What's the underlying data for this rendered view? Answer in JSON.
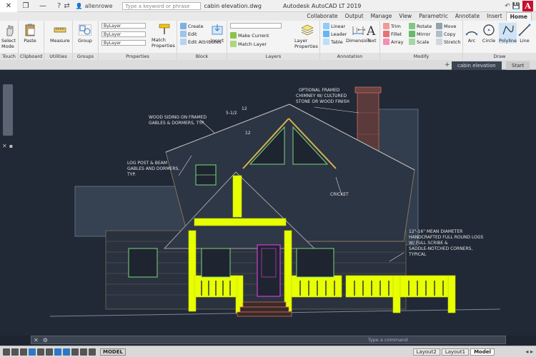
{
  "titlebar": {
    "title": "Autodesk AutoCAD LT 2019",
    "filename": "cabin elevation.dwg",
    "search_placeholder": "Type a keyword or phrase",
    "user": "allenrowe"
  },
  "ribbon_tabs": [
    "Home",
    "Insert",
    "Annotate",
    "Parametric",
    "View",
    "Manage",
    "Output",
    "Collaborate"
  ],
  "ribbon_active_tab": "Home",
  "panels": {
    "draw": {
      "title": "Draw",
      "items": [
        "Line",
        "Polyline",
        "Circle",
        "Arc"
      ]
    },
    "modify": {
      "title": "Modify",
      "items": [
        "Move",
        "Rotate",
        "Trim",
        "Copy",
        "Mirror",
        "Fillet",
        "Stretch",
        "Scale",
        "Array"
      ]
    },
    "annotation": {
      "title": "Annotation",
      "items": [
        "Text",
        "Dimension",
        "Linear",
        "Leader",
        "Table"
      ]
    },
    "layers": {
      "title": "Layers",
      "items": [
        "Layer Properties",
        "Make Current",
        "Match Layer"
      ]
    },
    "block": {
      "title": "Block",
      "items": [
        "Insert",
        "Create",
        "Edit",
        "Edit Attributes"
      ]
    },
    "properties": {
      "title": "Properties",
      "items": [
        "Match Properties",
        "ByLayer",
        "ByLayer",
        "ByLayer"
      ]
    },
    "groups": {
      "title": "Groups",
      "items": [
        "Group"
      ]
    },
    "utilities": {
      "title": "Utilities",
      "items": [
        "Measure"
      ]
    },
    "clipboard": {
      "title": "Clipboard",
      "items": [
        "Paste"
      ]
    },
    "touch": {
      "title": "Touch",
      "items": [
        "Select Mode"
      ]
    }
  },
  "doc_tabs": {
    "start": "Start",
    "drawing": "cabin elevation"
  },
  "annotations": {
    "chimney": [
      "OPTIONAL FRAMED",
      "CHIMNEY W/ CULTURED",
      "STONE OR WOOD FINISH"
    ],
    "siding": [
      "WOOD SIDING ON FRAMED",
      "GABLES & DORMERS, TYP."
    ],
    "logpost": [
      "LOG POST & BEAM",
      "GABLES AND DORMERS,",
      "TYP."
    ],
    "cricket": [
      "CRICKET"
    ],
    "logs": [
      "12\"-16\" MEAN DIAMETER",
      "HANDCRAFTED FULL ROUND LOGS",
      "W/ FULL SCRIBE &",
      "SADDLE-NOTCHED CORNERS,",
      "TYPICAL"
    ],
    "pitch1": "5-1/2",
    "pitch2": "12",
    "pitch3": "12"
  },
  "command_placeholder": "Type a command",
  "status": {
    "model": "MODEL",
    "tabs": [
      "Model",
      "Layout1",
      "Layout2"
    ],
    "active_tab": "Model"
  },
  "colors": {
    "accent": "#2f77c4",
    "highlight": "#e7ff00",
    "canvas": "#212936"
  }
}
